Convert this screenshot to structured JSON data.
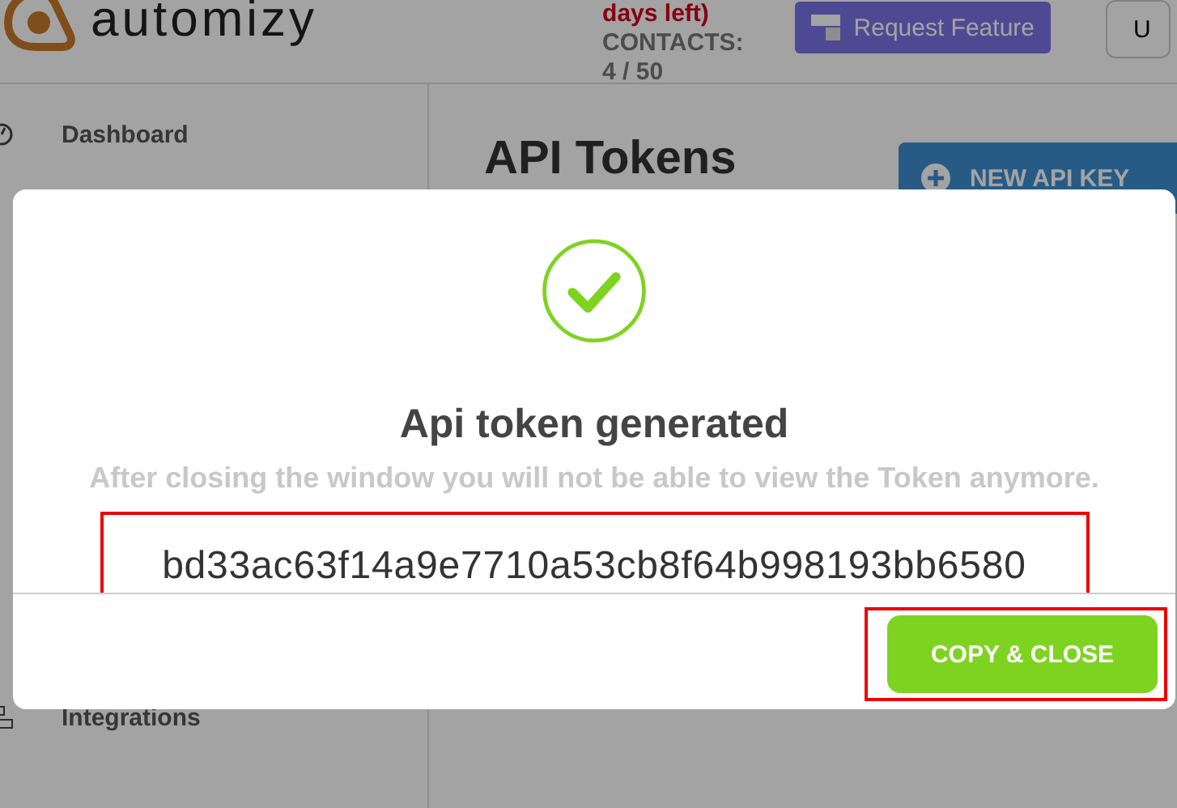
{
  "header": {
    "logo": "automizy",
    "trial": "days left)",
    "contacts_label": "CONTACTS:",
    "contacts_count": "4 / 50",
    "request_button": "Request Feature",
    "user_button": "U"
  },
  "sidebar": {
    "items": [
      {
        "label": "Dashboard"
      },
      {
        "label": "Integrations"
      }
    ]
  },
  "main": {
    "title": "API Tokens",
    "new_button": "NEW API KEY"
  },
  "modal": {
    "title": "Api token generated",
    "message": "After closing the window you will not be able to view the Token anymore.",
    "token": "bd33ac63f14a9e7710a53cb8f64b998193bb6580",
    "button": "COPY & CLOSE"
  }
}
